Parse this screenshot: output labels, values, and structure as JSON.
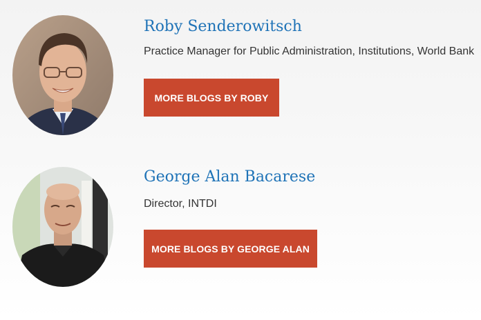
{
  "authors": [
    {
      "name": "Roby Senderowitsch",
      "role": "Practice Manager for Public Administration, Institutions, World Bank",
      "button_label": "MORE BLOGS BY ROBY"
    },
    {
      "name": "George Alan Bacarese",
      "role": "Director, INTDI",
      "button_label": "MORE BLOGS BY GEORGE ALAN"
    }
  ],
  "colors": {
    "name_link": "#1f73b7",
    "button_bg": "#c9482e",
    "button_text": "#ffffff",
    "role_text": "#333333"
  }
}
